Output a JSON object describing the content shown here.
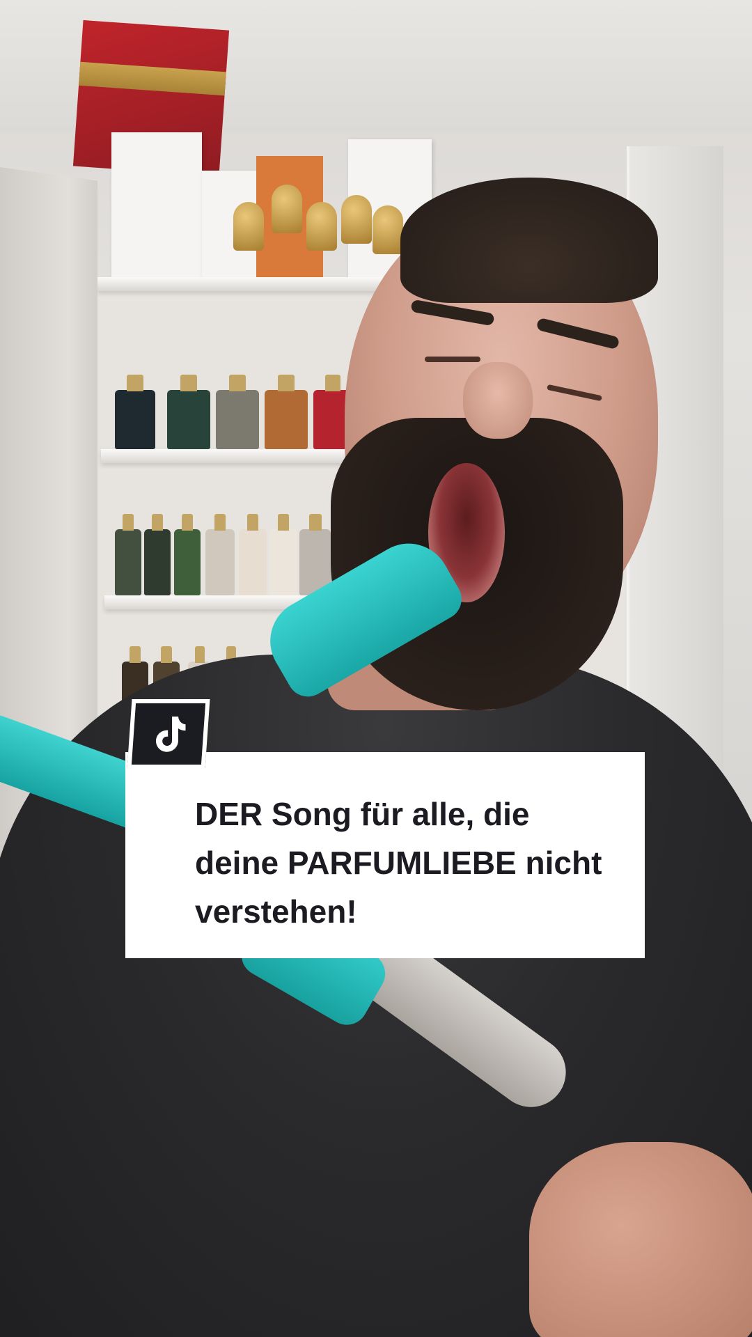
{
  "caption": {
    "text": "DER Song für alle, die deine PARFUMLIEBE nicht verstehen!"
  },
  "badge": {
    "icon": "tiktok-logo-icon"
  },
  "colors": {
    "card_background": "#ffffff",
    "card_text": "#1c1b22",
    "badge_background": "#1b1b22",
    "nozzle": "#1fb8b6"
  }
}
